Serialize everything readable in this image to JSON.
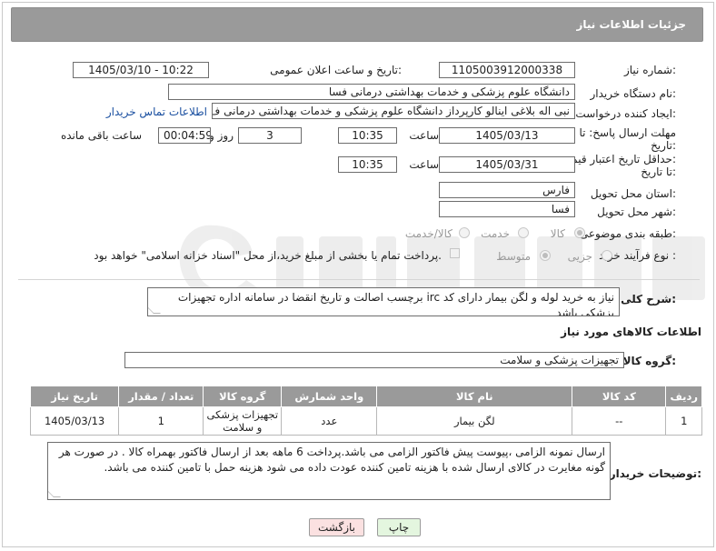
{
  "header": {
    "title": "جزئیات اطلاعات نیاز"
  },
  "form": {
    "need_number_label": "شماره نیاز:",
    "need_number": "1105003912000338",
    "announce_label": "تاریخ و ساعت اعلان عمومی:",
    "announce_value": "1405/03/10 - 10:22",
    "buyer_org_label": "نام دستگاه خریدار:",
    "buyer_org": "دانشگاه علوم پزشکی و خدمات بهداشتی درمانی فسا",
    "creator_label": "ایجاد کننده درخواست:",
    "creator": "نبی اله بلاغی اینالو کارپرداز دانشگاه علوم پزشکی و خدمات بهداشتی درمانی ف",
    "contact_link": "اطلاعات تماس خریدار",
    "reply_deadline_label_1": "مهلت ارسال پاسخ: تا",
    "reply_deadline_label_2": "تاریخ:",
    "reply_date": "1405/03/13",
    "time_label": "ساعت",
    "reply_time": "10:35",
    "days_value": "3",
    "days_label": "روز و",
    "remaining_value": "00:04:59",
    "remaining_label": "ساعت باقی مانده",
    "validity_label_1": "حداقل تاریخ اعتبار قیمت:",
    "validity_label_2": "تا تاریخ:",
    "validity_date": "1405/03/31",
    "validity_time": "10:35",
    "province_label": "استان محل تحویل:",
    "province": "فارس",
    "city_label": "شهر محل تحویل:",
    "city": "فسا",
    "category_label": "طبقه بندی موضوعی:",
    "category_options": [
      "کالا",
      "خدمت",
      "کالا/خدمت"
    ],
    "category_selected": "کالا",
    "process_label": "نوع فرآیند خرید :",
    "process_options": [
      "جزیی",
      "متوسط"
    ],
    "process_selected": "متوسط",
    "payment_note": "پرداخت تمام یا بخشی از مبلغ خرید،از محل \"اسناد خزانه اسلامی\" خواهد بود."
  },
  "description": {
    "label": "شرح کلی نیاز:",
    "text": "نیاز به خرید لوله و لگن بیمار دارای کد irc  برچسب اصالت و تاریخ انقضا در سامانه اداره تجهیزات پزشکی باشد"
  },
  "goods": {
    "section_title": "اطلاعات کالاهای مورد نیاز",
    "group_label": "گروه کالا:",
    "group_value": "تجهیزات پزشکی و سلامت",
    "columns": [
      "ردیف",
      "کد کالا",
      "نام کالا",
      "واحد شمارش",
      "گروه کالا",
      "تعداد / مقدار",
      "تاریخ نیاز"
    ],
    "rows": [
      [
        "1",
        "--",
        "لگن بیمار",
        "عدد",
        "تجهیزات پزشکی و سلامت",
        "1",
        "1405/03/13"
      ]
    ]
  },
  "buyer_notes": {
    "label": "توضیحات خریدار:",
    "text": "ارسال نمونه الزامی ،پیوست پیش فاکتور الزامی می باشد.پرداخت 6 ماهه بعد از ارسال فاکتور بهمراه کالا . در صورت هر گونه مغایرت در کالای ارسال شده با هزینه تامین کننده  عودت داده می شود  هزینه حمل با تامین  کننده می باشد."
  },
  "buttons": {
    "print": "چاپ",
    "back": "بازگشت"
  },
  "colors": {
    "header_bg": "#9a9a9a",
    "link": "#1a4fa0",
    "print_bg": "#e4f6df",
    "back_bg": "#fbe1e1"
  }
}
